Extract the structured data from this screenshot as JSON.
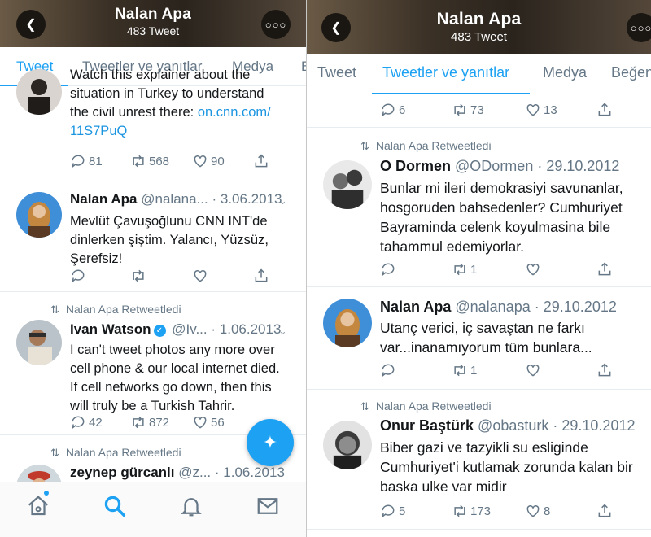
{
  "left": {
    "header": {
      "title": "Nalan Apa",
      "subtitle": "483 Tweet",
      "back_icon": "back-arrow-icon",
      "more_icon": "more-icon"
    },
    "tabs": [
      "Tweet",
      "Tweetler ve yanıtlar",
      "Medya",
      "B"
    ],
    "active_tab": 0,
    "tweets": [
      {
        "lines": [
          "Watch this explainer about the",
          "situation in Turkey to understand",
          "the civil unrest there: "
        ],
        "link": "on.cnn.com/",
        "link2": "11S7PuQ",
        "replies": "81",
        "retweets": "568",
        "likes": "90"
      },
      {
        "name": "Nalan Apa",
        "handle": "@nalana...",
        "date": "3.06.2013",
        "lines": [
          "Mevlüt Çavuşoğlunu CNN INT'de",
          "dinlerken şiştim. Yalancı, Yüzsüz,",
          "Şerefsiz!"
        ],
        "replies": "",
        "retweets": "",
        "likes": ""
      },
      {
        "retweeted_by": "Nalan Apa Retweetledi",
        "name": "Ivan Watson",
        "verified": true,
        "handle": "@Iv...",
        "date": "1.06.2013",
        "lines": [
          "I can't tweet photos any more over",
          "cell phone & our local internet died.",
          "If cell networks go down, then this",
          "will truly be a Turkish Tahrir."
        ],
        "replies": "42",
        "retweets": "872",
        "likes": "56"
      },
      {
        "retweeted_by": "Nalan Apa Retweetledi",
        "name": "zeynep gürcanlı",
        "handle": "@z...",
        "date": "1.06.2013"
      }
    ],
    "fab_icon": "compose-icon",
    "bottom_nav": [
      "home-icon",
      "search-icon",
      "notifications-icon",
      "messages-icon"
    ]
  },
  "right": {
    "header": {
      "title": "Nalan Apa",
      "subtitle": "483 Tweet",
      "back_icon": "back-arrow-icon",
      "more_icon": "more-icon"
    },
    "tabs": [
      "Tweet",
      "Tweetler ve yanıtlar",
      "Medya",
      "Beğen"
    ],
    "active_tab": 1,
    "tweets": [
      {
        "replies": "6",
        "retweets": "73",
        "likes": "13"
      },
      {
        "retweeted_by": "Nalan Apa Retweetledi",
        "name": "O Dormen",
        "handle": "@ODormen",
        "date": "29.10.2012",
        "lines": [
          "Bunlar mi ileri demokrasiyi savunanlar,",
          "hosgoruden bahsedenler? Cumhuriyet",
          "Bayraminda celenk koyulmasina bile",
          "tahammul edemiyorlar."
        ],
        "replies": "",
        "retweets": "1",
        "likes": ""
      },
      {
        "name": "Nalan Apa",
        "handle": "@nalanapa",
        "date": "29.10.2012",
        "lines": [
          "Utanç verici, iç savaştan ne farkı",
          "var...inanamıyorum tüm bunlara..."
        ],
        "replies": "",
        "retweets": "1",
        "likes": ""
      },
      {
        "retweeted_by": "Nalan Apa Retweetledi",
        "name": "Onur Baştürk",
        "handle": "@obasturk",
        "date": "29.10.2012",
        "lines": [
          "Biber gazi ve tazyikli su esliginde",
          "Cumhuriyet'i kutlamak zorunda kalan bir",
          "baska ulke var midir"
        ],
        "replies": "5",
        "retweets": "173",
        "likes": "8"
      }
    ]
  },
  "colors": {
    "accent": "#1da1f2",
    "secondary_text": "#657786",
    "link": "#1b95e0"
  }
}
